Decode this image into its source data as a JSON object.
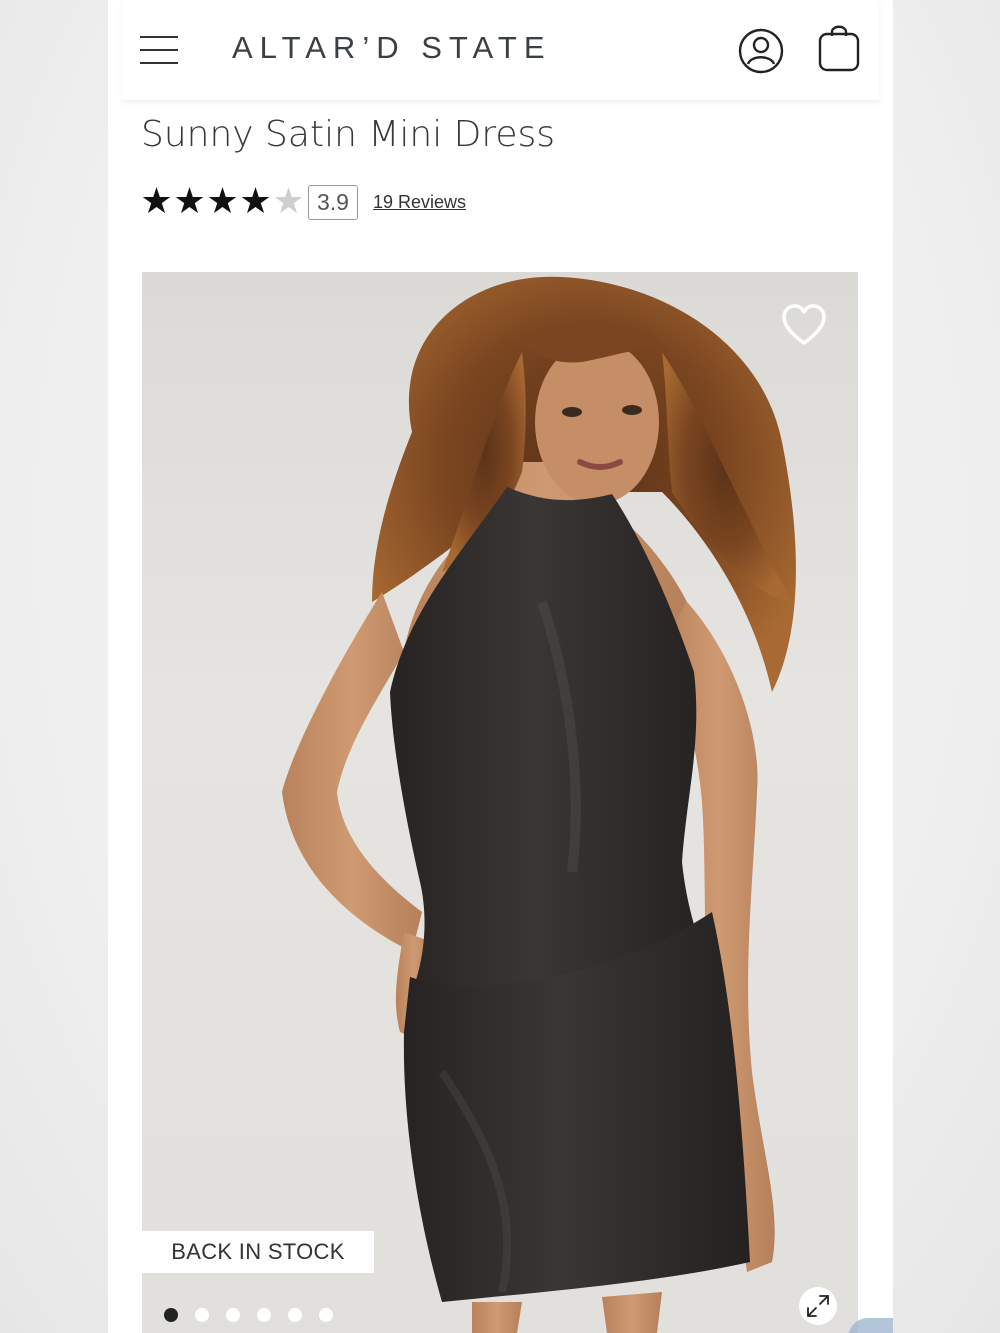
{
  "header": {
    "brand": "ALTAR’D STATE",
    "menu_icon": "hamburger-menu-icon",
    "account_icon": "account-icon",
    "bag_icon": "shopping-bag-icon"
  },
  "product": {
    "title": "Sunny Satin Mini Dress",
    "rating": {
      "stars_filled": 4,
      "stars_total": 5,
      "score": "3.9",
      "reviews_label": "19 Reviews"
    }
  },
  "gallery": {
    "badge": "BACK IN STOCK",
    "wishlist_icon": "heart-icon",
    "expand_icon": "expand-icon",
    "dots_total": 6,
    "active_index": 0
  },
  "colors": {
    "brand_text": "#3a4144",
    "star_filled": "#111111",
    "star_empty": "#cfcfcf",
    "dress": "#2f2c2b"
  }
}
